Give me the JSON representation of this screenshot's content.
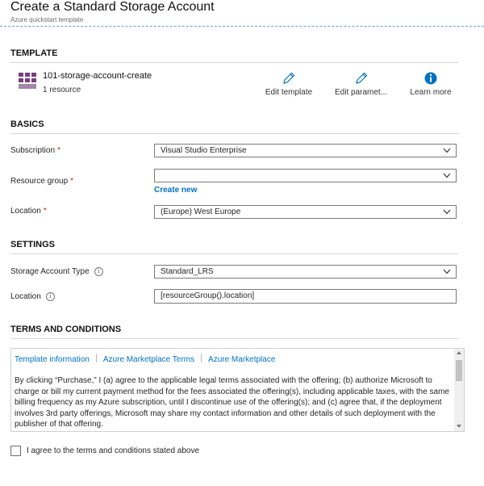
{
  "header": {
    "title": "Create a Standard Storage Account",
    "subtitle": "Azure quickstart template"
  },
  "template": {
    "section_title": "TEMPLATE",
    "name": "101-storage-account-create",
    "resource_count": "1 resource",
    "icon": "template-grid-icon",
    "actions": [
      {
        "label": "Edit template",
        "icon": "pencil-icon"
      },
      {
        "label": "Edit paramet...",
        "icon": "pencil-icon"
      },
      {
        "label": "Learn more",
        "icon": "info-circle-icon"
      }
    ]
  },
  "basics": {
    "section_title": "BASICS",
    "subscription": {
      "label": "Subscription",
      "value": "Visual Studio Enterprise"
    },
    "resource_group": {
      "label": "Resource group",
      "value": "",
      "create_new": "Create new"
    },
    "location": {
      "label": "Location",
      "value": "(Europe) West Europe"
    }
  },
  "settings": {
    "section_title": "SETTINGS",
    "storage_account_type": {
      "label": "Storage Account Type",
      "value": "Standard_LRS"
    },
    "location": {
      "label": "Location",
      "value": "[resourceGroup().location]"
    }
  },
  "terms": {
    "section_title": "TERMS AND CONDITIONS",
    "tabs": [
      "Template information",
      "Azure Marketplace Terms",
      "Azure Marketplace"
    ],
    "text": "By clicking “Purchase,” I (a) agree to the applicable legal terms associated with the offering; (b) authorize Microsoft to charge or bill my current payment method for the fees associated the offering(s), including applicable taxes, with the same billing frequency as my Azure subscription, until I discontinue use of the offering(s); and (c) agree that, if the deployment involves 3rd party offerings, Microsoft may share my contact information and other details of such deployment with the publisher of that offering.",
    "agree_label": "I agree to the terms and conditions stated above",
    "agreed": false
  },
  "colors": {
    "accent": "#0072c6",
    "required": "#c41e1e",
    "template_icon": "#7a3d7f"
  }
}
